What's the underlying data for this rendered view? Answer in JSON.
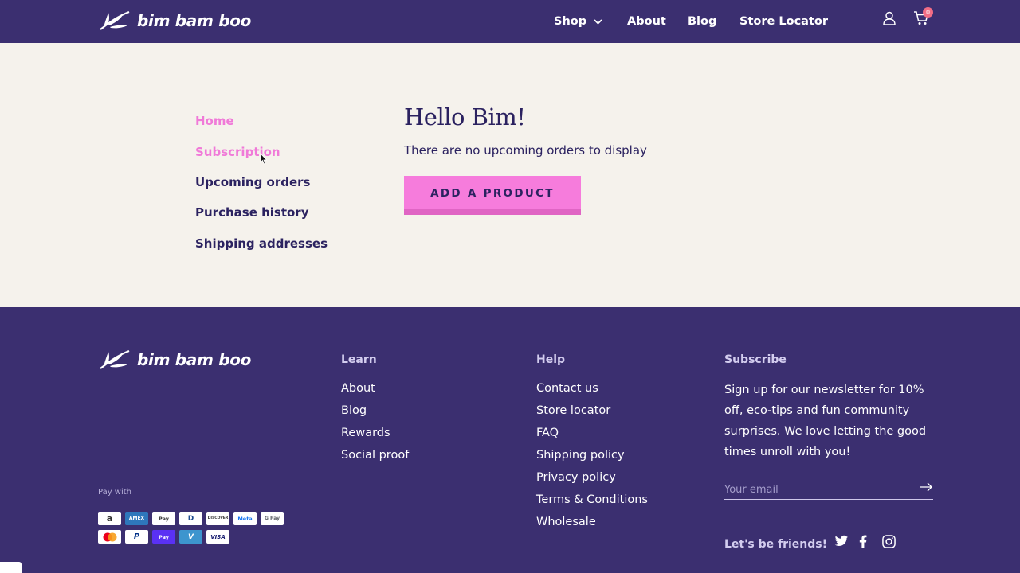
{
  "header": {
    "brand": "bim bam boo",
    "nav": {
      "shop": "Shop",
      "about": "About",
      "blog": "Blog",
      "store_locator": "Store Locator"
    },
    "cart_count": "0"
  },
  "account": {
    "sidebar": [
      {
        "label": "Home"
      },
      {
        "label": "Subscription"
      },
      {
        "label": "Upcoming orders"
      },
      {
        "label": "Purchase history"
      },
      {
        "label": "Shipping addresses"
      }
    ],
    "greeting": "Hello Bim!",
    "empty_message": "There are no upcoming orders to display",
    "add_button": "ADD A PRODUCT"
  },
  "footer": {
    "brand": "bim bam boo",
    "learn": {
      "title": "Learn",
      "links": [
        "About",
        "Blog",
        "Rewards",
        "Social proof"
      ]
    },
    "help": {
      "title": "Help",
      "links": [
        "Contact us",
        "Store locator",
        "FAQ",
        "Shipping policy",
        "Privacy policy",
        "Terms & Conditions",
        "Wholesale"
      ]
    },
    "subscribe": {
      "title": "Subscribe",
      "text": "Sign up for our newsletter for 10% off, eco-tips and fun community surprises. We love letting the good times unroll with you!",
      "email_placeholder": "Your email",
      "friends": "Let's be friends!"
    },
    "pay_with": "Pay with",
    "payment_methods_row1": [
      "a",
      "AMEX",
      "Pay",
      "D",
      "DISCOVER",
      "Meta",
      "G Pay"
    ],
    "payment_methods_row2": [
      "",
      "P",
      "Pay",
      "V",
      "VISA"
    ]
  },
  "colors": {
    "navy": "#3b2f70",
    "pink": "#f67cdc",
    "cream": "#f5f2ec",
    "badge": "#f26d85"
  }
}
